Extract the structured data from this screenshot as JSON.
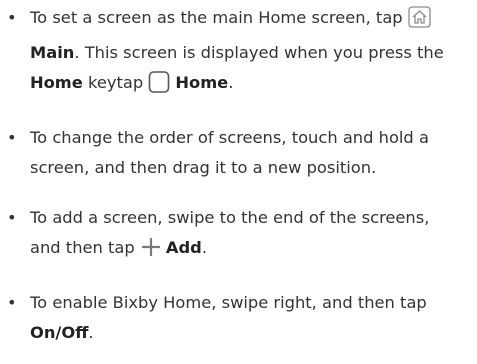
{
  "instructions": [
    {
      "pre": "To set a screen as the main Home screen, tap",
      "icon": "home-icon",
      "bold": "Main",
      "mid": ". This screen is displayed when you press the",
      "bold2": "Home",
      "mid2": "keytap",
      "icon2": "home-key-icon",
      "bold3": "Home",
      "end": "."
    },
    {
      "text": "To change the order of screens, touch and hold a screen, and then drag it to a new position."
    },
    {
      "pre": "To add a screen, swipe to the end of the screens, and then tap",
      "icon": "plus-icon",
      "bold": "Add",
      "end": "."
    },
    {
      "pre": "To enable Bixby Home, swipe right, and then tap",
      "bold": "On/Off",
      "end": "."
    }
  ]
}
